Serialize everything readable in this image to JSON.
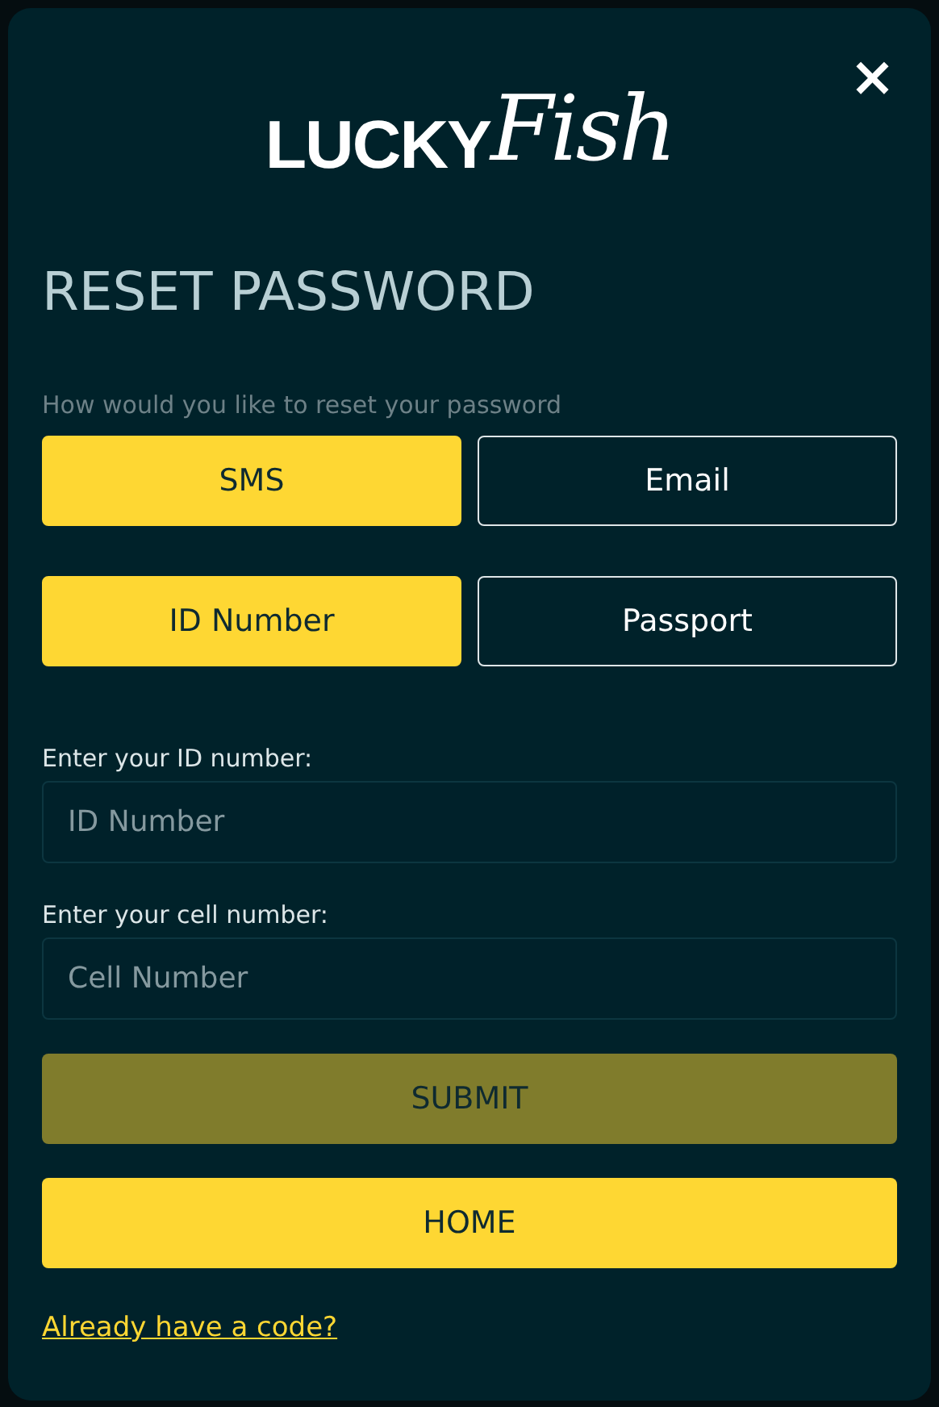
{
  "logo": {
    "word": "LUCKY",
    "script": "Fish"
  },
  "close": {
    "label": "×"
  },
  "title": "RESET PASSWORD",
  "prompt": "How would you like to reset your password",
  "option_rows": [
    {
      "options": [
        {
          "label": "SMS",
          "selected": true
        },
        {
          "label": "Email",
          "selected": false
        }
      ]
    },
    {
      "options": [
        {
          "label": "ID Number",
          "selected": true
        },
        {
          "label": "Passport",
          "selected": false
        }
      ]
    }
  ],
  "fields": [
    {
      "label": "Enter your ID number:",
      "placeholder": "ID Number"
    },
    {
      "label": "Enter your cell number:",
      "placeholder": "Cell Number"
    }
  ],
  "buttons": [
    {
      "label": "SUBMIT",
      "disabled": true
    },
    {
      "label": "HOME",
      "disabled": false
    }
  ],
  "link": "Already have a code?"
}
